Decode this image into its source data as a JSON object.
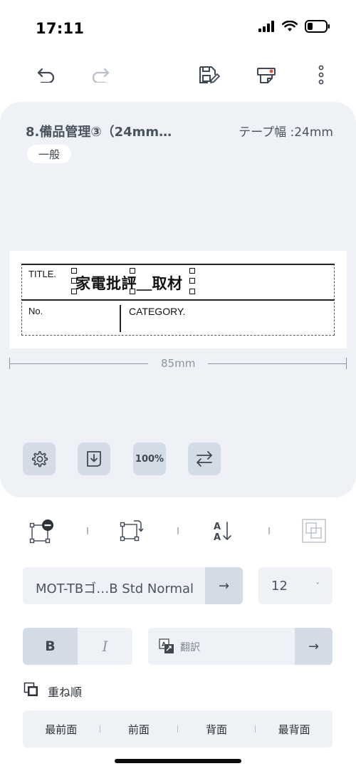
{
  "status_bar": {
    "time": "17:11"
  },
  "toolbar": {
    "icons": [
      "undo-icon",
      "redo-icon",
      "save-edit-icon",
      "print-icon",
      "more-icon"
    ]
  },
  "document": {
    "title": "8.備品管理③（24mm…",
    "tape_width": "テープ幅 :24mm",
    "category": "一般",
    "label": {
      "title_field": "TITLE.",
      "main_text": "家電批評＿取材",
      "no_field": "No.",
      "category_field": "CATEGORY."
    },
    "length": "85mm",
    "zoom_label": "100%"
  },
  "format": {
    "font_name": "MOT-TBゴ…B Std Normal",
    "font_arrow": "→",
    "font_size": "12",
    "size_chevron": "ˇ",
    "bold": "B",
    "italic": "I",
    "translate_placeholder": "翻訳",
    "translate_arrow": "→",
    "stack_order_label": "重ね順",
    "order_buttons": [
      "最前面",
      "前面",
      "背面",
      "最背面"
    ]
  },
  "colors": {
    "card_bg": "#eef2f6",
    "button_bg": "#d3dce6",
    "text": "#2c3238"
  }
}
